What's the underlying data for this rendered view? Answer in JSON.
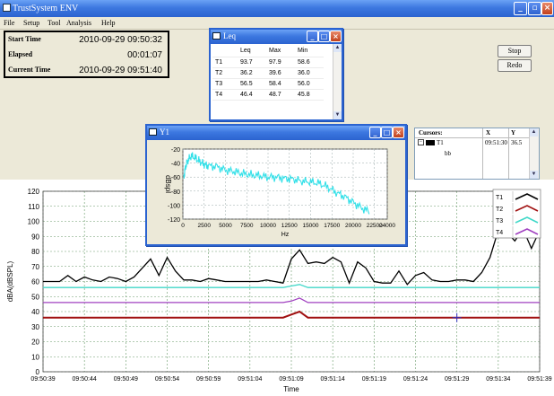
{
  "app": {
    "title": "TrustSystem ENV"
  },
  "menu": [
    "File",
    "Setup",
    "Tool",
    "Analysis",
    "Help"
  ],
  "time_panel": {
    "start_label": "Start Time",
    "start_value": "2010-09-29 09:50:32",
    "elapsed_label": "Elapsed",
    "elapsed_value": "00:01:07",
    "current_label": "Current Time",
    "current_value": "2010-09-29 09:51:40"
  },
  "buttons": {
    "stop": "Stop",
    "redo": "Redo"
  },
  "leq_window": {
    "title": "Leq",
    "columns": [
      "",
      "Leq",
      "Max",
      "Min"
    ],
    "rows": [
      [
        "T1",
        "93.7",
        "97.9",
        "58.6"
      ],
      [
        "T2",
        "36.2",
        "39.6",
        "36.0"
      ],
      [
        "T3",
        "56.5",
        "58.4",
        "56.0"
      ],
      [
        "T4",
        "46.4",
        "48.7",
        "45.8"
      ]
    ]
  },
  "cursors_panel": {
    "header_name": "Cursors:",
    "header_x": "X",
    "header_y": "Y",
    "row_name": "T1",
    "row_x": "09:51:30",
    "row_y": "36.5",
    "sub_item": "bb"
  },
  "spectrum_window": {
    "title": "Y1",
    "chart_data": {
      "type": "line",
      "xlabel": "Hz",
      "ylabel": "dBspl",
      "xlim": [
        0,
        24000
      ],
      "ylim": [
        -120,
        -20
      ],
      "xticks": [
        0,
        2500,
        5000,
        7500,
        10000,
        12500,
        15000,
        17500,
        20000,
        22500,
        24000
      ],
      "yticks": [
        -20,
        -40,
        -60,
        -80,
        -100,
        -120
      ],
      "color": "#33e0e8",
      "x": [
        100,
        300,
        600,
        1000,
        1500,
        2000,
        2500,
        3000,
        4000,
        5000,
        6000,
        7000,
        8000,
        9000,
        10000,
        11000,
        12000,
        13000,
        14000,
        15000,
        16000,
        17000,
        18000,
        19000,
        20000,
        21000,
        22000
      ],
      "y": [
        -62,
        -45,
        -36,
        -30,
        -33,
        -38,
        -42,
        -44,
        -45,
        -50,
        -52,
        -55,
        -57,
        -58,
        -60,
        -60,
        -62,
        -63,
        -66,
        -67,
        -69,
        -74,
        -82,
        -88,
        -96,
        -104,
        -110
      ]
    }
  },
  "main_chart": {
    "chart_data": {
      "type": "line",
      "xlabel": "Time",
      "ylabel": "dBA(dBSPL)",
      "ylim": [
        0,
        120
      ],
      "yticks": [
        0,
        10,
        20,
        30,
        40,
        50,
        60,
        70,
        80,
        90,
        100,
        110,
        120
      ],
      "xticks": [
        "09:50:39",
        "09:50:44",
        "09:50:49",
        "09:50:54",
        "09:50:59",
        "09:51:04",
        "09:51:09",
        "09:51:14",
        "09:51:19",
        "09:51:24",
        "09:51:29",
        "09:51:34",
        "09:51:39"
      ],
      "x_seconds": [
        0,
        1,
        2,
        3,
        4,
        5,
        6,
        7,
        8,
        9,
        10,
        11,
        12,
        13,
        14,
        15,
        16,
        17,
        18,
        19,
        20,
        21,
        22,
        23,
        24,
        25,
        26,
        27,
        28,
        29,
        30,
        31,
        32,
        33,
        34,
        35,
        36,
        37,
        38,
        39,
        40,
        41,
        42,
        43,
        44,
        45,
        46,
        47,
        48,
        49,
        50,
        51,
        52,
        53,
        54,
        55,
        56,
        57,
        58,
        59,
        60
      ],
      "series": [
        {
          "name": "T1",
          "color": "#000000",
          "values": [
            60,
            60,
            60,
            64,
            60,
            63,
            61,
            60,
            63,
            62,
            60,
            63,
            69,
            75,
            64,
            76,
            67,
            61,
            61,
            60,
            62,
            61,
            60,
            60,
            60,
            60,
            60,
            61,
            60,
            59,
            75,
            81,
            72,
            73,
            72,
            76,
            73,
            59,
            73,
            69,
            60,
            59,
            59,
            67,
            58,
            64,
            66,
            61,
            60,
            60,
            61,
            61,
            60,
            66,
            76,
            94,
            93,
            87,
            95,
            82,
            94
          ]
        },
        {
          "name": "T2",
          "color": "#a01010",
          "values": [
            36,
            36,
            36,
            36,
            36,
            36,
            36,
            36,
            36,
            36,
            36,
            36,
            36,
            36,
            36,
            36,
            36,
            36,
            36,
            36,
            36,
            36,
            36,
            36,
            36,
            36,
            36,
            36,
            36,
            36,
            38,
            40,
            36,
            36,
            36,
            36,
            36,
            36,
            36,
            36,
            36,
            36,
            36,
            36,
            36,
            36,
            36,
            36,
            36,
            36,
            36,
            36,
            36,
            36,
            36,
            36,
            36,
            36,
            36,
            36,
            36
          ]
        },
        {
          "name": "T3",
          "color": "#40d8c8",
          "values": [
            56,
            56,
            56,
            56,
            56,
            56,
            56,
            56,
            56,
            56,
            56,
            56,
            56,
            56,
            56,
            56,
            56,
            56,
            56,
            56,
            56,
            56,
            56,
            56,
            56,
            56,
            56,
            56,
            56,
            56,
            57,
            58,
            56,
            56,
            56,
            56,
            56,
            56,
            56,
            56,
            56,
            56,
            56,
            56,
            56,
            56,
            56,
            56,
            56,
            56,
            56,
            56,
            56,
            56,
            56,
            56,
            56,
            56,
            56,
            56,
            56
          ]
        },
        {
          "name": "T4",
          "color": "#a040c0",
          "values": [
            46,
            46,
            46,
            46,
            46,
            46,
            46,
            46,
            46,
            46,
            46,
            46,
            46,
            46,
            46,
            46,
            46,
            46,
            46,
            46,
            46,
            46,
            46,
            46,
            46,
            46,
            46,
            46,
            46,
            46,
            47,
            49,
            46,
            46,
            46,
            46,
            46,
            46,
            46,
            46,
            46,
            46,
            46,
            46,
            46,
            46,
            46,
            46,
            46,
            46,
            46,
            46,
            46,
            46,
            46,
            46,
            46,
            46,
            46,
            46,
            46
          ]
        }
      ],
      "legend_position": "top-right"
    }
  }
}
